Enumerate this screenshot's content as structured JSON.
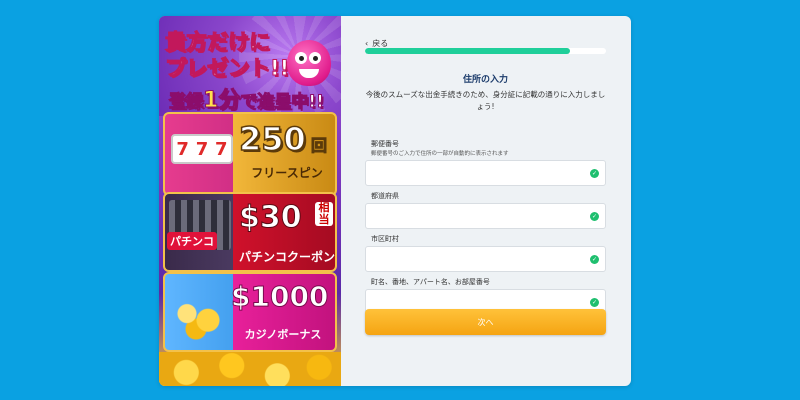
{
  "promo": {
    "headline_1": "貴方だけに",
    "headline_2": "プレゼント!!",
    "headline_3_pre": "登録",
    "headline_3_big": "1分",
    "headline_3_post": "で進呈中!!",
    "offer1": {
      "reels": [
        "7",
        "7",
        "7"
      ],
      "amount": "250",
      "unit": "回",
      "label": "フリースピン"
    },
    "offer2": {
      "tag": "パチンコ",
      "amount": "$30",
      "unit": "相当",
      "label": "パチンコクーポン"
    },
    "offer3": {
      "amount": "$1000",
      "label": "カジノボーナス"
    }
  },
  "form": {
    "back_label": "戻る",
    "progress_percent": 85,
    "title": "住所の入力",
    "description": "今後のスムーズな出金手続きのため、身分証に記載の通りに入力しましょう!",
    "fields": [
      {
        "label": "郵便番号",
        "hint": "郵便番号のご入力で住所の一部が自動的に表示されます",
        "value": ""
      },
      {
        "label": "都道府県",
        "hint": "",
        "value": ""
      },
      {
        "label": "市区町村",
        "hint": "",
        "value": ""
      },
      {
        "label": "町名、番地、アパート名、お部屋番号",
        "hint": "",
        "value": ""
      }
    ],
    "next_label": "次へ"
  },
  "colors": {
    "background": "#0aa1e2",
    "progress": "#1fcf9a",
    "button": "#f5a412",
    "check": "#1fbf6f"
  }
}
